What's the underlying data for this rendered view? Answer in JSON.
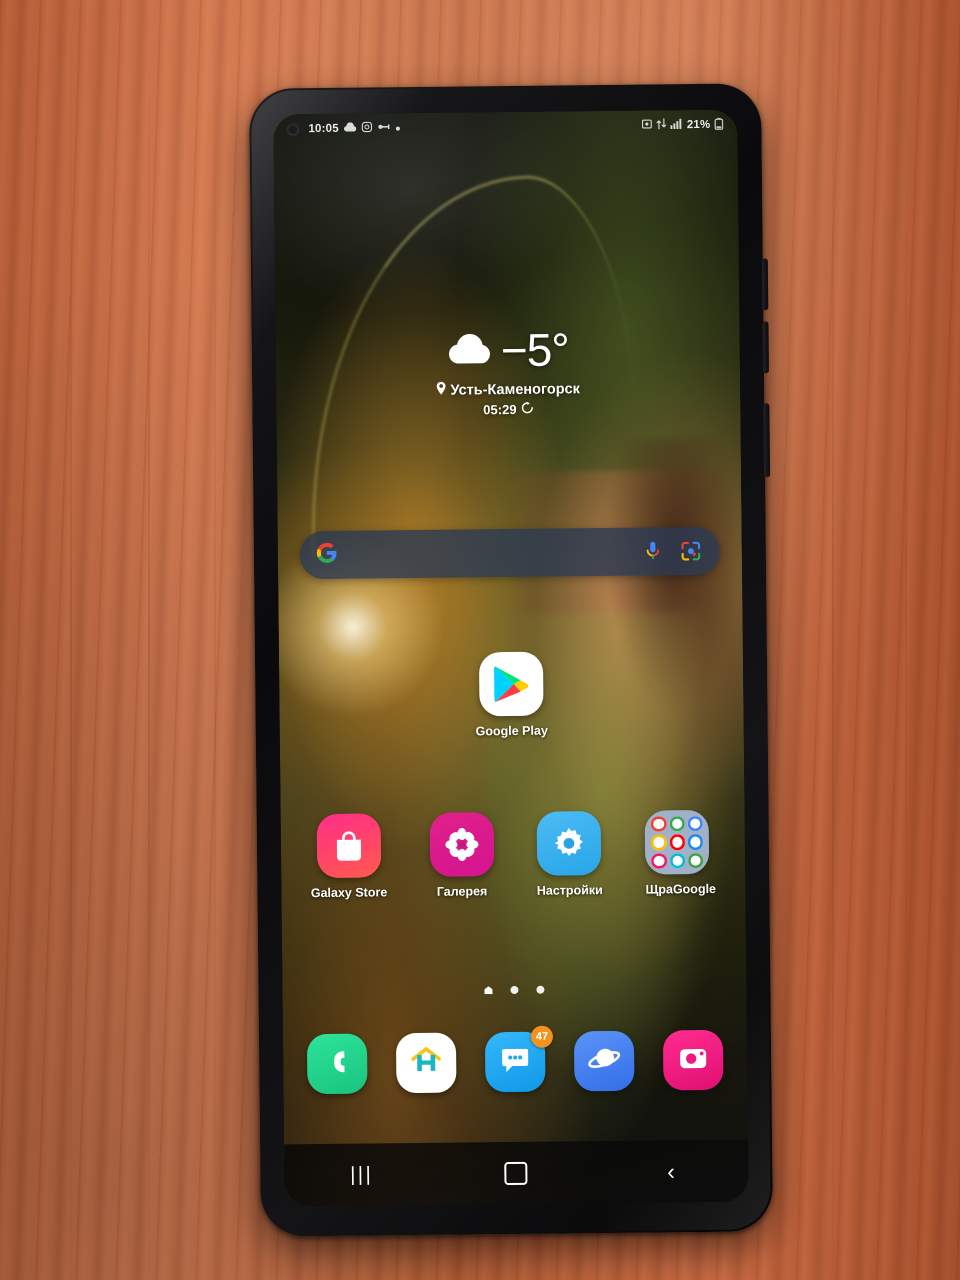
{
  "device": {
    "kind": "smartphone",
    "surface": "wooden-desk",
    "desk_color": "#cb6b3e",
    "case_color": "#111114"
  },
  "status_bar": {
    "time": "10:05",
    "left_icons": [
      "cloud-icon",
      "instagram-icon",
      "link-icon",
      "dot-icon"
    ],
    "right_icons": [
      "screenshot-icon",
      "data-transfer-icon",
      "signal-bars-icon"
    ],
    "battery_percent": "21%",
    "battery_icon": "battery-low-icon"
  },
  "weather_widget": {
    "condition_icon": "cloud-icon",
    "temperature": "−5°",
    "location_icon": "location-pin-icon",
    "city": "Усть-Каменогорск",
    "updated_time": "05:29",
    "refresh_icon": "refresh-icon"
  },
  "search": {
    "logo": "google-g-icon",
    "placeholder": "",
    "value": "",
    "voice_icon": "microphone-icon",
    "lens_icon": "google-lens-icon",
    "bar_color": "#2a3a52"
  },
  "home_screen": {
    "featured_app": {
      "label": "Google Play",
      "icon": "google-play-icon",
      "bg": "#ffffff"
    },
    "apps": [
      {
        "label": "Galaxy Store",
        "icon": "shopping-bag-icon",
        "bg": "#f0357f"
      },
      {
        "label": "Галерея",
        "icon": "flower-icon",
        "bg": "#e0218a"
      },
      {
        "label": "Настройки",
        "icon": "gear-icon",
        "bg": "#3eb2f0"
      },
      {
        "label": "ЩраGoogle",
        "icon": "folder-icon",
        "bg": "#9fb0c8"
      }
    ],
    "folder_mini_colors": [
      "#ea4335",
      "#34a853",
      "#4285f4",
      "#fbbc05",
      "#ff0000",
      "#1e88e5",
      "#e91e63",
      "#00bcd4",
      "#43a047"
    ],
    "page_indicator": {
      "pages": 3,
      "current": 1
    }
  },
  "dock": [
    {
      "label": "Телефон",
      "icon": "phone-handset-icon",
      "bg": "#24d08a",
      "badge": ""
    },
    {
      "label": "Home",
      "icon": "home-h-icon",
      "bg": "#ffffff",
      "badge": ""
    },
    {
      "label": "Сообщения",
      "icon": "chat-bubble-icon",
      "bg": "#1ba6f0",
      "badge": "47"
    },
    {
      "label": "Интернет",
      "icon": "saturn-planet-icon",
      "bg": "#3d7ef2",
      "badge": ""
    },
    {
      "label": "Камера",
      "icon": "camera-icon",
      "bg": "#f0157f",
      "badge": ""
    }
  ],
  "nav_bar": {
    "recents_label": "|||",
    "recents_icon": "recents-icon",
    "home_icon": "home-square-icon",
    "back_label": "‹",
    "back_icon": "back-chevron-icon"
  }
}
